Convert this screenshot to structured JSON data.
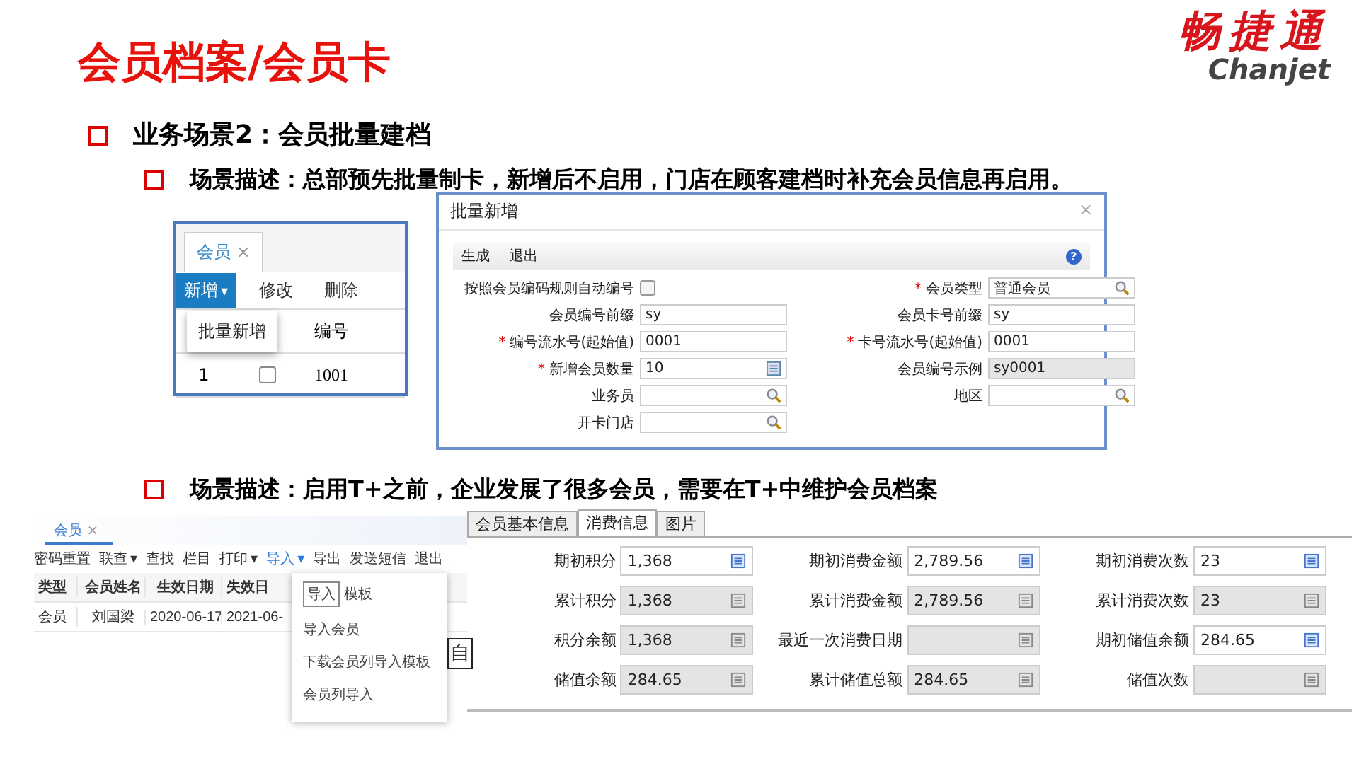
{
  "title": "会员档案/会员卡",
  "logo": {
    "name": "畅捷通",
    "sub": "Chanjet"
  },
  "section": {
    "heading": "业务场景2：会员批量建档",
    "scenarios": [
      {
        "text": "场景描述：总部预先批量制卡，新增后不启用，门店在顾客建档时补充会员信息再启用。"
      },
      {
        "text": "场景描述：启用T+之前，企业发展了很多会员，需要在T+中维护会员档案"
      }
    ]
  },
  "list_screen": {
    "tab": "会员",
    "close": "×",
    "toolbar": [
      {
        "label": "新增",
        "selected": true,
        "caret": "▾"
      },
      {
        "label": "修改",
        "selected": false
      },
      {
        "label": "删除",
        "selected": false
      }
    ],
    "menu": [
      "批量新增"
    ],
    "column": "编号",
    "row": {
      "index": "1",
      "checked": false,
      "code": "1001"
    }
  },
  "dialog": {
    "title": "批量新增",
    "close": "×",
    "toolbar": [
      "生成",
      "退出"
    ],
    "help": "?",
    "required_mark": "*",
    "left": [
      {
        "label": "按照会员编码规则自动编号",
        "kind": "checkbox",
        "required": false,
        "checked": false
      },
      {
        "label": "会员编号前缀",
        "kind": "text",
        "required": false,
        "value": "sy"
      },
      {
        "label": "编号流水号(起始值)",
        "kind": "text",
        "required": true,
        "value": "0001"
      },
      {
        "label": "新增会员数量",
        "kind": "calc",
        "required": true,
        "value": "10"
      },
      {
        "label": "业务员",
        "kind": "lookup",
        "required": false
      },
      {
        "label": "开卡门店",
        "kind": "lookup",
        "required": false
      }
    ],
    "right": [
      {
        "label": "会员类型",
        "kind": "lookup",
        "required": true,
        "value": "普通会员"
      },
      {
        "label": "会员卡号前缀",
        "kind": "text",
        "required": false,
        "value": "sy"
      },
      {
        "label": "卡号流水号(起始值)",
        "kind": "text",
        "required": true,
        "value": "0001"
      },
      {
        "label": "会员编号示例",
        "kind": "readonly",
        "required": false,
        "value": "sy0001"
      },
      {
        "label": "地区",
        "kind": "lookup",
        "required": false
      }
    ]
  },
  "import_screen": {
    "tab": "会员",
    "close": "×",
    "toolbar": [
      {
        "label": "密码重置",
        "selected": false
      },
      {
        "label": "联查",
        "selected": false,
        "caret": "▾"
      },
      {
        "label": "查找",
        "selected": false
      },
      {
        "label": "栏目",
        "selected": false
      },
      {
        "label": "打印",
        "selected": false,
        "caret": "▾"
      },
      {
        "label": "导入",
        "selected": true,
        "caret": "▾"
      },
      {
        "label": "导出",
        "selected": false
      },
      {
        "label": "发送短信",
        "selected": false
      },
      {
        "label": "退出",
        "selected": false
      }
    ],
    "columns": [
      "类型",
      "会员姓名",
      "生效日期",
      "失效日"
    ],
    "row": [
      "会员",
      "刘国梁",
      "2020-06-17",
      "2021-06-"
    ],
    "tooltip": "导入",
    "menu": [
      "模板",
      "导入会员",
      "下载会员列导入模板",
      "会员列导入"
    ],
    "side_text": "自"
  },
  "consume_panel": {
    "tabs": [
      {
        "label": "会员基本信息",
        "selected": false
      },
      {
        "label": "消费信息",
        "selected": true
      },
      {
        "label": "图片",
        "selected": false
      }
    ],
    "fields": [
      {
        "label": "期初积分",
        "value": "1,368",
        "editable": true
      },
      {
        "label": "期初消费金额",
        "value": "2,789.56",
        "editable": true
      },
      {
        "label": "期初消费次数",
        "value": "23",
        "editable": true
      },
      {
        "label": "累计积分",
        "value": "1,368",
        "editable": false
      },
      {
        "label": "累计消费金额",
        "value": "2,789.56",
        "editable": false
      },
      {
        "label": "累计消费次数",
        "value": "23",
        "editable": false
      },
      {
        "label": "积分余额",
        "value": "1,368",
        "editable": false
      },
      {
        "label": "最近一次消费日期",
        "editable": false
      },
      {
        "label": "期初储值余额",
        "value": "284.65",
        "editable": true
      },
      {
        "label": "储值余额",
        "value": "284.65",
        "editable": false
      },
      {
        "label": "累计储值总额",
        "value": "284.65",
        "editable": false
      },
      {
        "label": "储值次数",
        "editable": false
      }
    ]
  }
}
